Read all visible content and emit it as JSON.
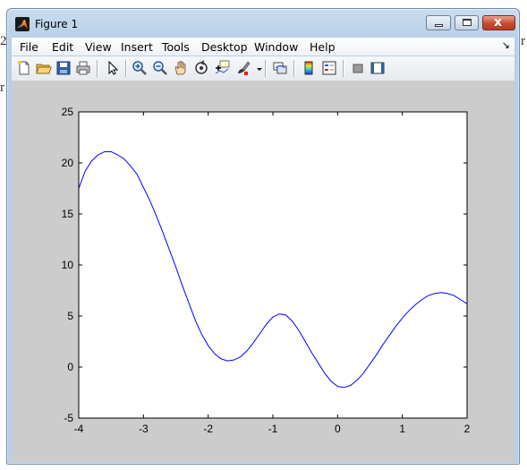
{
  "window": {
    "title": "Figure 1",
    "controls": {
      "minimize": "minimize",
      "maximize": "maximize",
      "close": "x"
    }
  },
  "menubar": {
    "items": [
      "File",
      "Edit",
      "View",
      "Insert",
      "Tools",
      "Desktop",
      "Window",
      "Help"
    ],
    "overflow_glyph": "↘"
  },
  "toolbar": {
    "buttons": [
      "new-figure-icon",
      "open-file-icon",
      "save-icon",
      "print-icon",
      "pointer-arrow-icon",
      "zoom-in-icon",
      "zoom-out-icon",
      "pan-hand-icon",
      "rotate-3d-icon",
      "data-cursor-icon",
      "brush-icon",
      "link-plot-icon",
      "colorbar-icon",
      "legend-icon",
      "hide-plot-tools-icon",
      "show-plot-tools-icon"
    ]
  },
  "background_fragments": {
    "left_char": "r",
    "top_left_char": "2",
    "top_right_char": "r"
  },
  "colors": {
    "line": "#0000ff",
    "figure_bg": "#cccccc",
    "axes_bg": "#ffffff"
  },
  "chart_data": {
    "type": "line",
    "title": "",
    "xlabel": "",
    "ylabel": "",
    "xlim": [
      -4,
      2
    ],
    "ylim": [
      -5,
      25
    ],
    "xticks": [
      -4,
      -3,
      -2,
      -1,
      0,
      1,
      2
    ],
    "yticks": [
      -5,
      0,
      5,
      10,
      15,
      20,
      25
    ],
    "grid": false,
    "series": [
      {
        "x": [
          -4.0,
          -3.9,
          -3.8,
          -3.7,
          -3.6,
          -3.5,
          -3.4,
          -3.3,
          -3.2,
          -3.1,
          -3.0,
          -2.9,
          -2.8,
          -2.7,
          -2.6,
          -2.5,
          -2.4,
          -2.3,
          -2.2,
          -2.1,
          -2.0,
          -1.9,
          -1.8,
          -1.7,
          -1.6,
          -1.5,
          -1.4,
          -1.3,
          -1.2,
          -1.1,
          -1.0,
          -0.9,
          -0.8,
          -0.7,
          -0.6,
          -0.5,
          -0.4,
          -0.3,
          -0.2,
          -0.1,
          0.0,
          0.1,
          0.2,
          0.3,
          0.4,
          0.5,
          0.6,
          0.7,
          0.8,
          0.9,
          1.0,
          1.1,
          1.2,
          1.3,
          1.4,
          1.5,
          1.6,
          1.7,
          1.8,
          1.9,
          2.0
        ],
        "y": [
          17.5,
          19.2,
          20.2,
          20.8,
          21.1,
          21.1,
          20.8,
          20.4,
          19.7,
          18.9,
          17.6,
          16.3,
          14.8,
          13.2,
          11.5,
          9.8,
          8.0,
          6.3,
          4.6,
          3.2,
          2.1,
          1.3,
          0.8,
          0.6,
          0.7,
          1.0,
          1.6,
          2.4,
          3.3,
          4.2,
          4.9,
          5.2,
          5.1,
          4.5,
          3.6,
          2.5,
          1.4,
          0.4,
          -0.6,
          -1.4,
          -1.9,
          -2.0,
          -1.8,
          -1.3,
          -0.6,
          0.3,
          1.2,
          2.2,
          3.1,
          4.0,
          4.8,
          5.5,
          6.1,
          6.6,
          7.0,
          7.2,
          7.3,
          7.2,
          7.0,
          6.6,
          6.2
        ]
      }
    ]
  }
}
